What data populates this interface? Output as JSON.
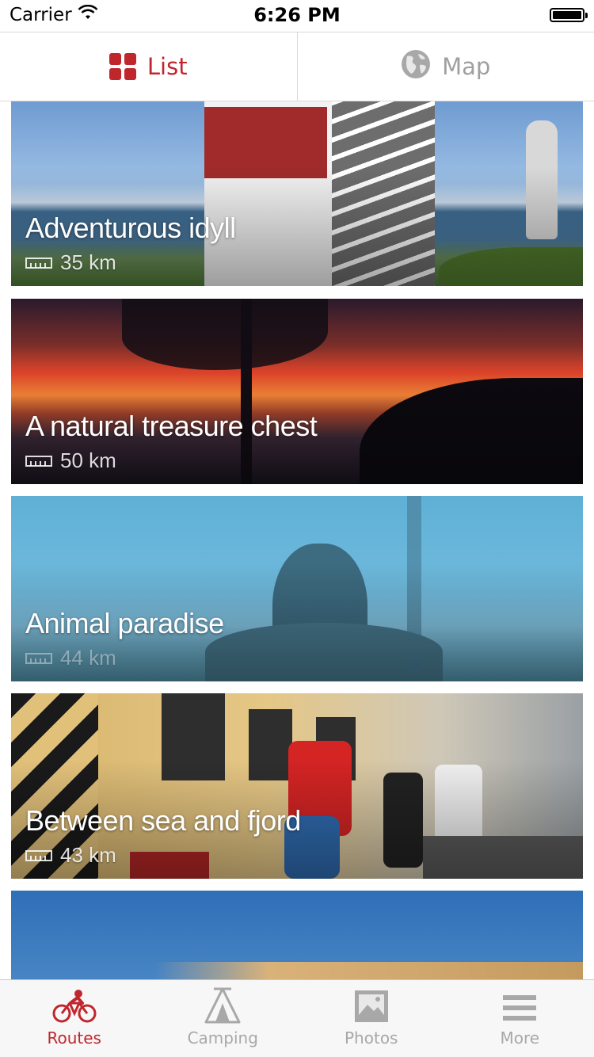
{
  "status": {
    "carrier": "Carrier",
    "time": "6:26 PM"
  },
  "segments": [
    {
      "label": "List",
      "icon": "grid-icon",
      "active": true
    },
    {
      "label": "Map",
      "icon": "globe-icon",
      "active": false
    }
  ],
  "routes": [
    {
      "title": "Adventurous idyll",
      "distance": "35 km"
    },
    {
      "title": "A natural treasure chest",
      "distance": "50 km"
    },
    {
      "title": "Animal paradise",
      "distance": "44 km"
    },
    {
      "title": "Between sea and fjord",
      "distance": "43 km"
    },
    {
      "title": "",
      "distance": ""
    }
  ],
  "tabs": [
    {
      "label": "Routes",
      "icon": "bicycle-icon",
      "active": true
    },
    {
      "label": "Camping",
      "icon": "tent-icon",
      "active": false
    },
    {
      "label": "Photos",
      "icon": "photo-icon",
      "active": false
    },
    {
      "label": "More",
      "icon": "menu-icon",
      "active": false
    }
  ],
  "colors": {
    "accent": "#c0272d",
    "inactive": "#a8a8a8"
  }
}
